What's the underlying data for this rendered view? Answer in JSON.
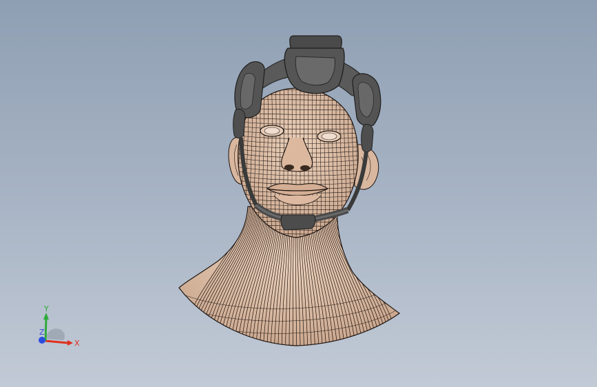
{
  "viewport": {
    "background_top": "#8f9fb3",
    "background_bottom": "#c2cad6"
  },
  "model": {
    "skin_color": "#e2c3aa",
    "mesh_line_color": "#1c1410",
    "headset_color": "#4f4f4f",
    "headset_dark": "#2a2a2a"
  },
  "triad": {
    "x_label": "X",
    "y_label": "Y",
    "z_label": "Z",
    "x_color": "#e0301e",
    "y_color": "#2eaa3a",
    "z_color": "#2a4de0"
  }
}
